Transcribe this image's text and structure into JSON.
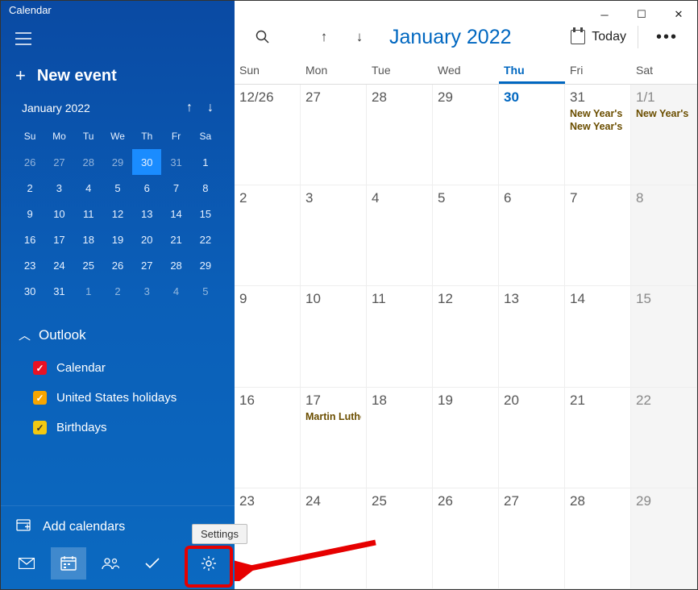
{
  "window": {
    "title": "Calendar"
  },
  "sidebar": {
    "new_event": "New event",
    "mini": {
      "title": "January 2022",
      "weekdays": [
        "Su",
        "Mo",
        "Tu",
        "We",
        "Th",
        "Fr",
        "Sa"
      ],
      "rows": [
        [
          {
            "d": "26",
            "dim": true
          },
          {
            "d": "27",
            "dim": true
          },
          {
            "d": "28",
            "dim": true
          },
          {
            "d": "29",
            "dim": true
          },
          {
            "d": "30",
            "today": true
          },
          {
            "d": "31",
            "dim": true
          },
          {
            "d": "1"
          }
        ],
        [
          {
            "d": "2"
          },
          {
            "d": "3"
          },
          {
            "d": "4"
          },
          {
            "d": "5"
          },
          {
            "d": "6"
          },
          {
            "d": "7"
          },
          {
            "d": "8"
          }
        ],
        [
          {
            "d": "9"
          },
          {
            "d": "10"
          },
          {
            "d": "11"
          },
          {
            "d": "12"
          },
          {
            "d": "13"
          },
          {
            "d": "14"
          },
          {
            "d": "15"
          }
        ],
        [
          {
            "d": "16"
          },
          {
            "d": "17"
          },
          {
            "d": "18"
          },
          {
            "d": "19"
          },
          {
            "d": "20"
          },
          {
            "d": "21"
          },
          {
            "d": "22"
          }
        ],
        [
          {
            "d": "23"
          },
          {
            "d": "24"
          },
          {
            "d": "25"
          },
          {
            "d": "26"
          },
          {
            "d": "27"
          },
          {
            "d": "28"
          },
          {
            "d": "29"
          }
        ],
        [
          {
            "d": "30"
          },
          {
            "d": "31"
          },
          {
            "d": "1",
            "dim": true
          },
          {
            "d": "2",
            "dim": true
          },
          {
            "d": "3",
            "dim": true
          },
          {
            "d": "4",
            "dim": true
          },
          {
            "d": "5",
            "dim": true
          }
        ]
      ]
    },
    "account_label": "Outlook",
    "calendars": [
      {
        "label": "Calendar",
        "color": "red"
      },
      {
        "label": "United States holidays",
        "color": "orange"
      },
      {
        "label": "Birthdays",
        "color": "yellow"
      }
    ],
    "add_label": "Add calendars",
    "settings_tooltip": "Settings"
  },
  "toolbar": {
    "month_title": "January 2022",
    "today_label": "Today"
  },
  "grid": {
    "weekdays": [
      "Sun",
      "Mon",
      "Tue",
      "Wed",
      "Thu",
      "Fri",
      "Sat"
    ],
    "today_col_index": 4,
    "rows": [
      [
        {
          "label": "12/26",
          "other": true
        },
        {
          "label": "27",
          "other": true
        },
        {
          "label": "28",
          "other": true
        },
        {
          "label": "29",
          "other": true
        },
        {
          "label": "30",
          "today": true,
          "other": true
        },
        {
          "label": "31",
          "other": true,
          "events": [
            "New Year's",
            "New Year's"
          ]
        },
        {
          "label": "1/1",
          "sat": true,
          "events": [
            "New Year's"
          ]
        }
      ],
      [
        {
          "label": "2"
        },
        {
          "label": "3"
        },
        {
          "label": "4"
        },
        {
          "label": "5"
        },
        {
          "label": "6"
        },
        {
          "label": "7"
        },
        {
          "label": "8",
          "sat": true
        }
      ],
      [
        {
          "label": "9"
        },
        {
          "label": "10"
        },
        {
          "label": "11"
        },
        {
          "label": "12"
        },
        {
          "label": "13"
        },
        {
          "label": "14"
        },
        {
          "label": "15",
          "sat": true
        }
      ],
      [
        {
          "label": "16"
        },
        {
          "label": "17",
          "events": [
            "Martin Luther"
          ]
        },
        {
          "label": "18"
        },
        {
          "label": "19"
        },
        {
          "label": "20"
        },
        {
          "label": "21"
        },
        {
          "label": "22",
          "sat": true
        }
      ],
      [
        {
          "label": "23"
        },
        {
          "label": "24"
        },
        {
          "label": "25"
        },
        {
          "label": "26"
        },
        {
          "label": "27"
        },
        {
          "label": "28"
        },
        {
          "label": "29",
          "sat": true
        }
      ]
    ]
  }
}
